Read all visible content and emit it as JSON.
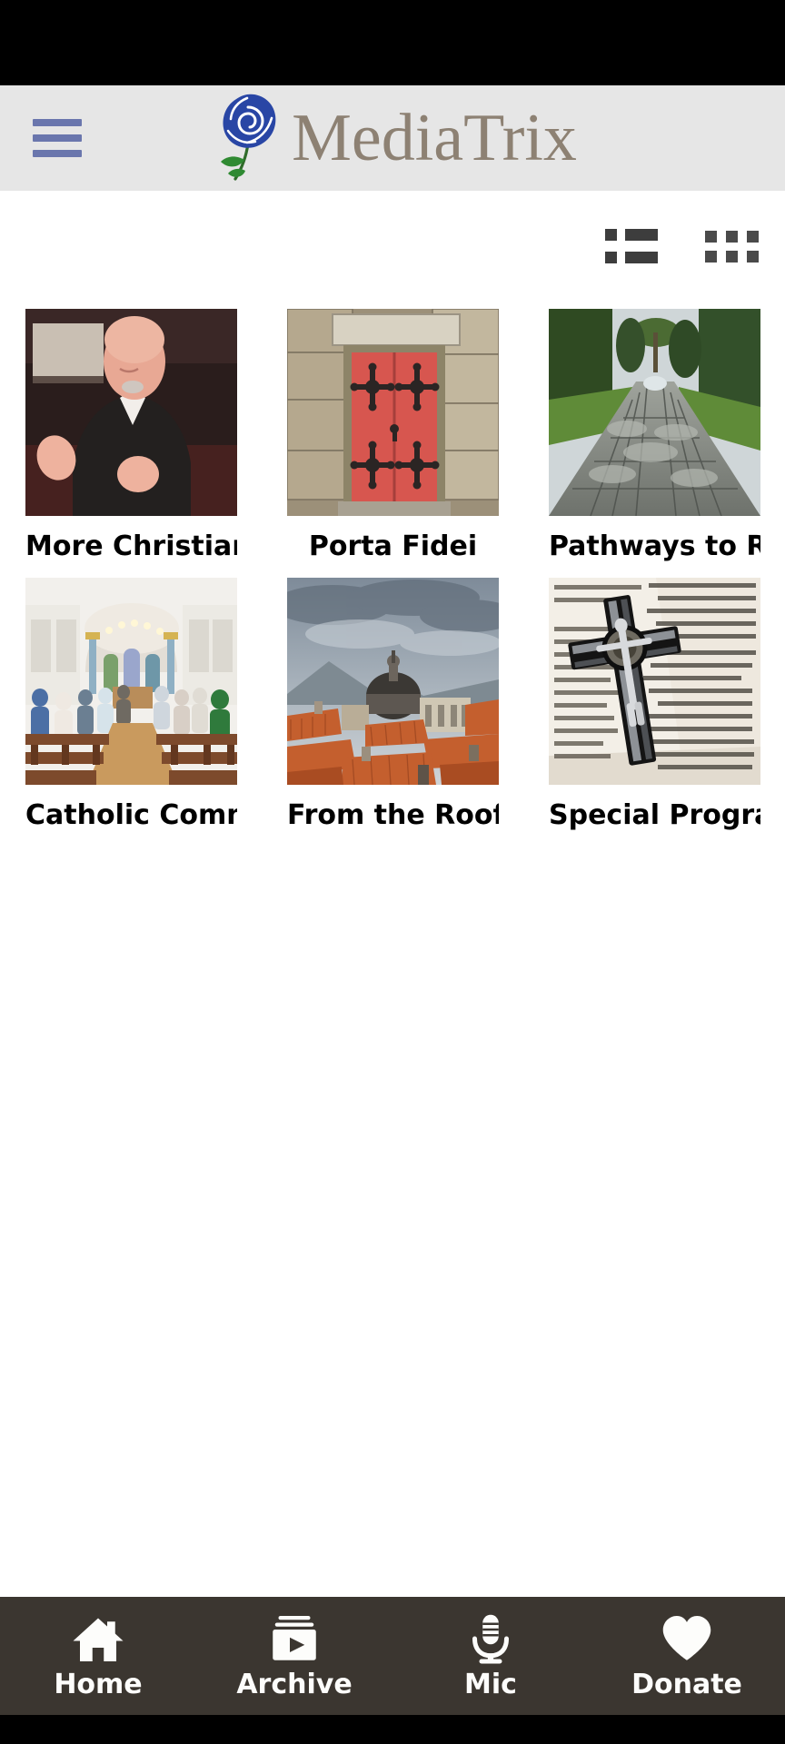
{
  "header": {
    "menu_icon": "hamburger-menu-icon",
    "logo_icon": "blue-rose-logo-icon",
    "brand_name": "MediaTrix",
    "brand_color": "#8d8173",
    "background_color": "#e6e6e6",
    "menu_color": "#6a76ad"
  },
  "view_toggles": [
    {
      "name": "list-view-toggle",
      "icon": "list-view-icon",
      "label": "List view"
    },
    {
      "name": "grid-view-toggle",
      "icon": "grid-view-icon",
      "label": "Grid view"
    }
  ],
  "grid": {
    "columns": 3,
    "items": [
      {
        "title": "More Christianity",
        "image": "priest-speaking-photo"
      },
      {
        "title": "Porta Fidei",
        "image": "red-church-door-photo"
      },
      {
        "title": "Pathways to Ro...",
        "image": "roman-cobblestone-road-photo"
      },
      {
        "title": "Catholic Commu...",
        "image": "church-congregation-interior-photo"
      },
      {
        "title": "From the Rooftop",
        "image": "terracotta-rooftops-dome-photo"
      },
      {
        "title": "Special Programs",
        "image": "crucifix-on-bible-photo"
      }
    ]
  },
  "bottom_nav": {
    "background_color": "#3b3630",
    "items": [
      {
        "label": "Home",
        "icon": "home-icon"
      },
      {
        "label": "Archive",
        "icon": "archive-video-icon"
      },
      {
        "label": "Mic",
        "icon": "microphone-icon"
      },
      {
        "label": "Donate",
        "icon": "heart-icon"
      }
    ]
  }
}
